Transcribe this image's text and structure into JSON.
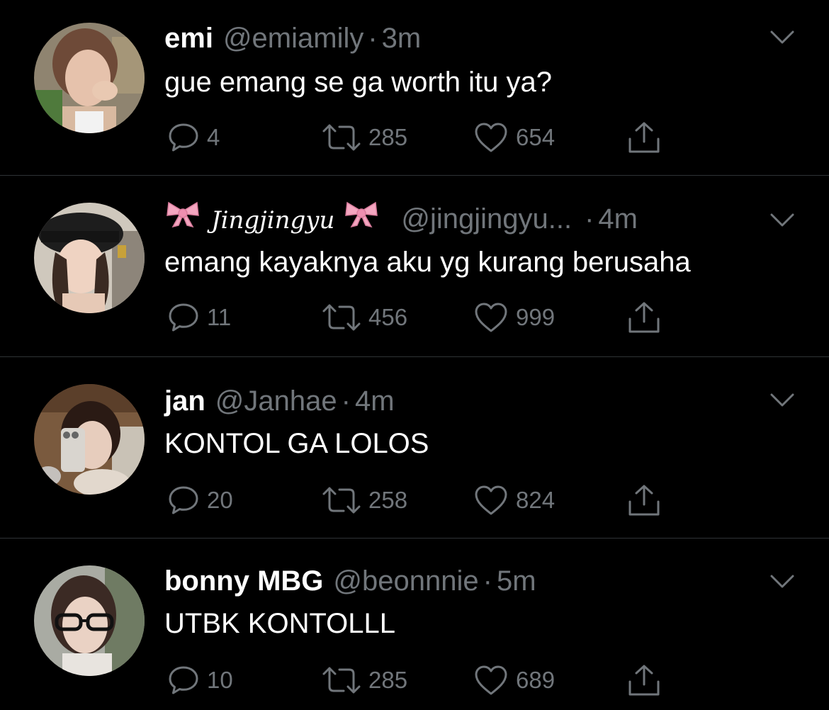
{
  "colors": {
    "background": "#000000",
    "divider": "#2f3336",
    "primary_text": "#ffffff",
    "secondary_text": "#71767b",
    "bow": "#f4a6c0"
  },
  "icons": {
    "reply": "speech-bubble-icon",
    "retweet": "retweet-arrows-icon",
    "like": "heart-icon",
    "share": "share-upload-icon",
    "more": "chevron-down-icon",
    "decoration": "pink-bow-emoji"
  },
  "tweets": [
    {
      "name": "emi",
      "handle": "@emiamily",
      "separator": "·",
      "time": "3m",
      "text": "gue emang se ga worth itu ya?",
      "replies": "4",
      "retweets": "285",
      "likes": "654"
    },
    {
      "name": "Jingjingyu",
      "handle": "@jingjingyu...",
      "separator": "·",
      "time": "4m",
      "text": "emang kayaknya aku yg kurang berusaha",
      "replies": "11",
      "retweets": "456",
      "likes": "999"
    },
    {
      "name": "jan",
      "handle": "@Janhae",
      "separator": "·",
      "time": "4m",
      "text": "KONTOL GA LOLOS",
      "replies": "20",
      "retweets": "258",
      "likes": "824"
    },
    {
      "name": "bonny MBG",
      "handle": "@beonnnie",
      "separator": "·",
      "time": "5m",
      "text": "UTBK KONTOLLL",
      "replies": "10",
      "retweets": "285",
      "likes": "689"
    }
  ]
}
